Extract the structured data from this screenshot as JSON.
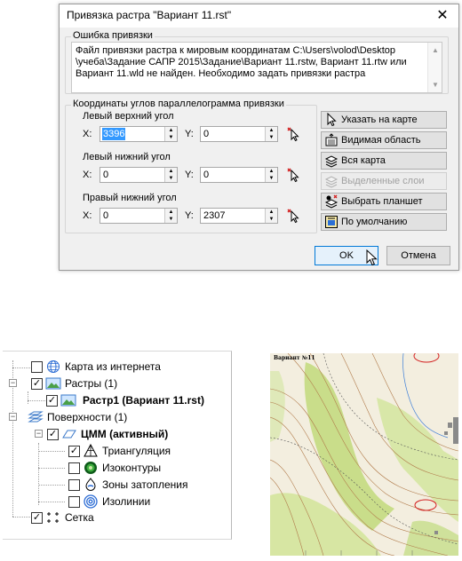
{
  "dialog": {
    "title": "Привязка растра \"Вариант 11.rst\"",
    "close_glyph": "✕",
    "error_group": {
      "legend": "Ошибка привязки",
      "message": "Файл привязки растра к мировым координатам C:\\Users\\volod\\Desktop \\учеба\\Задание САПР 2015\\Задание\\Вариант 11.rstw, Вариант 11.rtw или Вариант 11.wld не найден.  Необходимо задать привязки растра"
    },
    "coords_group": {
      "legend": "Координаты углов параллелограмма привязки",
      "x_label": "X:",
      "y_label": "Y:",
      "top_left": {
        "label": "Левый верхний угол",
        "x": "3396",
        "y": "0"
      },
      "bottom_left": {
        "label": "Левый нижний угол",
        "x": "0",
        "y": "0"
      },
      "bottom_right": {
        "label": "Правый нижний угол",
        "x": "0",
        "y": "2307"
      }
    },
    "side_buttons": {
      "pick_on_map": "Указать на карте",
      "visible_area": "Видимая область",
      "whole_map": "Вся карта",
      "selected_layers": "Выделенные слои",
      "choose_sheet": "Выбрать планшет",
      "default": "По умолчанию"
    },
    "ok_label": "OK",
    "cancel_label": "Отмена"
  },
  "tree": {
    "internet_map": "Карта из интернета",
    "rasters": "Растры (1)",
    "raster1": "Растр1 (Вариант 11.rst)",
    "surfaces": "Поверхности (1)",
    "dtm": "ЦММ (активный)",
    "triangulation": "Триангуляция",
    "isocontours": "Изоконтуры",
    "flood_zones": "Зоны затопления",
    "isolines": "Изолинии",
    "grid": "Сетка"
  },
  "map": {
    "sheet_title": "Вариант №11"
  },
  "colors": {
    "ok_border": "#0078d7",
    "selection": "#3399ff",
    "map_green": "#c9dd8a",
    "map_contour": "#b07a4a",
    "marker_red": "#d32020"
  }
}
